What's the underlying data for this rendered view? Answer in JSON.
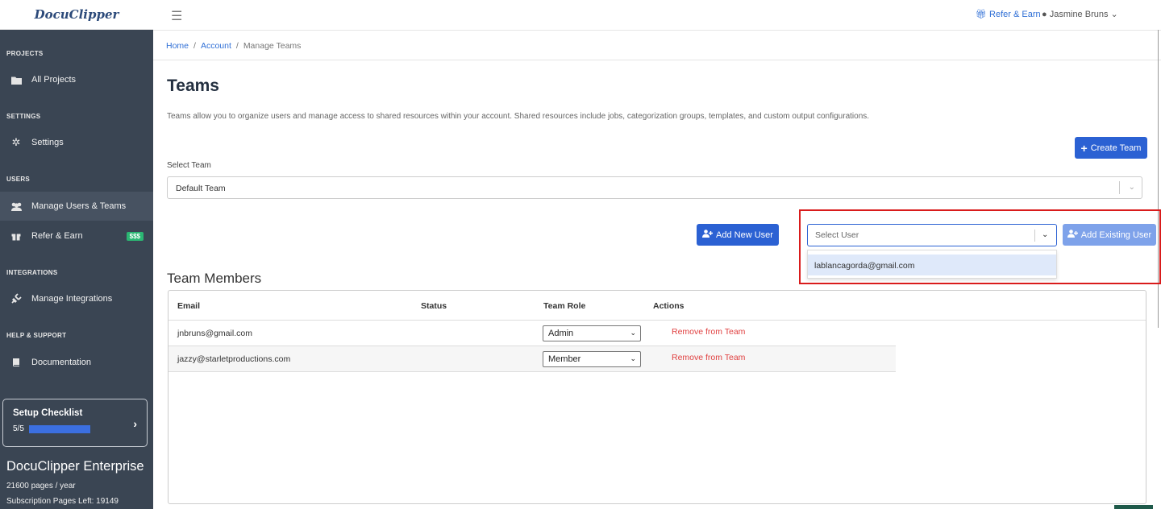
{
  "brand": {
    "logo_text": "DocuClipper"
  },
  "topbar": {
    "refer_label": "Refer & Earn",
    "user_name": "Jasmine Bruns"
  },
  "sidebar": {
    "sections": {
      "projects": "PROJECTS",
      "settings": "SETTINGS",
      "users": "USERS",
      "integrations": "INTEGRATIONS",
      "help": "HELP & SUPPORT"
    },
    "items": [
      {
        "label": "All Projects",
        "icon": "folder-icon"
      },
      {
        "label": "Settings",
        "icon": "gear-icon"
      },
      {
        "label": "Manage Users & Teams",
        "icon": "users-icon",
        "active": true
      },
      {
        "label": "Refer & Earn",
        "icon": "gift-icon",
        "badge": "$$$"
      },
      {
        "label": "Manage Integrations",
        "icon": "plug-icon"
      },
      {
        "label": "Documentation",
        "icon": "book-icon"
      }
    ],
    "checklist": {
      "title": "Setup Checklist",
      "progress_text": "5/5",
      "progress_fraction": 1.0
    },
    "plan": {
      "name": "DocuClipper Enterprise",
      "pages_per_year": "21600 pages / year",
      "pages_left": "Subscription Pages Left: 19149"
    }
  },
  "breadcrumb": {
    "home": "Home",
    "account": "Account",
    "current": "Manage Teams"
  },
  "main": {
    "title": "Teams",
    "description": "Teams allow you to organize users and manage access to shared resources within your account. Shared resources include jobs, categorization groups, templates, and custom output configurations.",
    "create_team_label": "Create Team",
    "select_team_label": "Select Team",
    "selected_team": "Default Team",
    "add_new_user_label": "Add New User",
    "user_select_placeholder": "Select User",
    "user_options": [
      "lablancagorda@gmail.com"
    ],
    "add_existing_user_label": "Add Existing User",
    "team_members_title": "Team Members",
    "table": {
      "headers": [
        "Email",
        "Status",
        "Team Role",
        "Actions"
      ],
      "rows": [
        {
          "email": "jnbruns@gmail.com",
          "status": "",
          "role": "Admin",
          "action": "Remove from Team"
        },
        {
          "email": "jazzy@starletproductions.com",
          "status": "",
          "role": "Member",
          "action": "Remove from Team"
        }
      ]
    }
  },
  "colors": {
    "sidebar_bg": "#3a4553",
    "primary": "#2b61d3",
    "danger": "#e04040",
    "highlight": "#d91b1b"
  }
}
